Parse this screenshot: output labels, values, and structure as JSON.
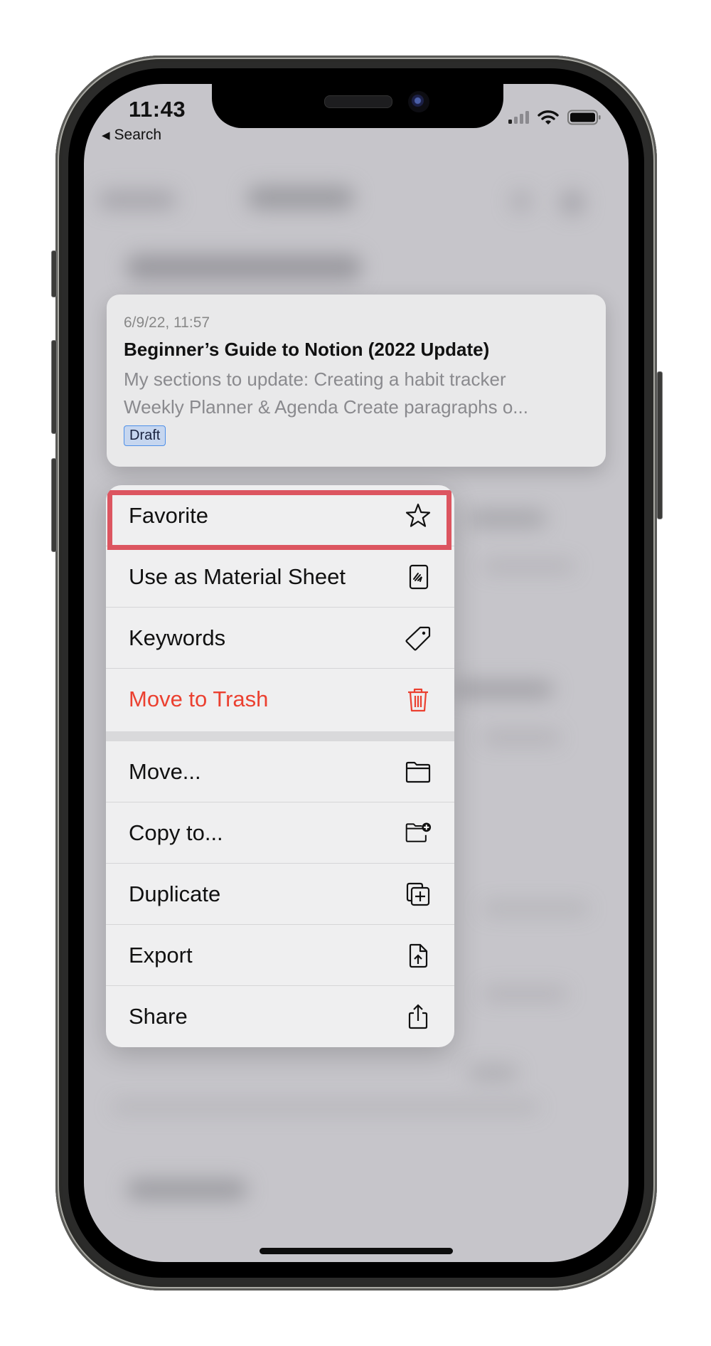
{
  "status_bar": {
    "time": "11:43",
    "back_label": "Search",
    "signal_icon": "cellular-signal-icon",
    "wifi_icon": "wifi-icon",
    "battery_icon": "battery-icon"
  },
  "preview_card": {
    "date": "6/9/22, 11:57",
    "title": "Beginner’s Guide to Notion (2022 Update)",
    "body_line1": "My sections to update: Creating a habit tracker",
    "body_line2": "Weekly Planner & Agenda Create paragraphs o...",
    "badge": "Draft"
  },
  "context_menu": {
    "highlight_color": "#dc5560",
    "destructive_color": "#eb4030",
    "group1": [
      {
        "label": "Favorite",
        "icon": "star-icon",
        "highlighted": true
      },
      {
        "label": "Use as Material Sheet",
        "icon": "material-sheet-icon"
      },
      {
        "label": "Keywords",
        "icon": "tag-icon"
      },
      {
        "label": "Move to Trash",
        "icon": "trash-icon",
        "destructive": true
      }
    ],
    "group2": [
      {
        "label": "Move...",
        "icon": "folder-icon"
      },
      {
        "label": "Copy to...",
        "icon": "folder-add-icon"
      },
      {
        "label": "Duplicate",
        "icon": "duplicate-icon"
      },
      {
        "label": "Export",
        "icon": "export-document-icon"
      },
      {
        "label": "Share",
        "icon": "share-icon"
      }
    ]
  }
}
